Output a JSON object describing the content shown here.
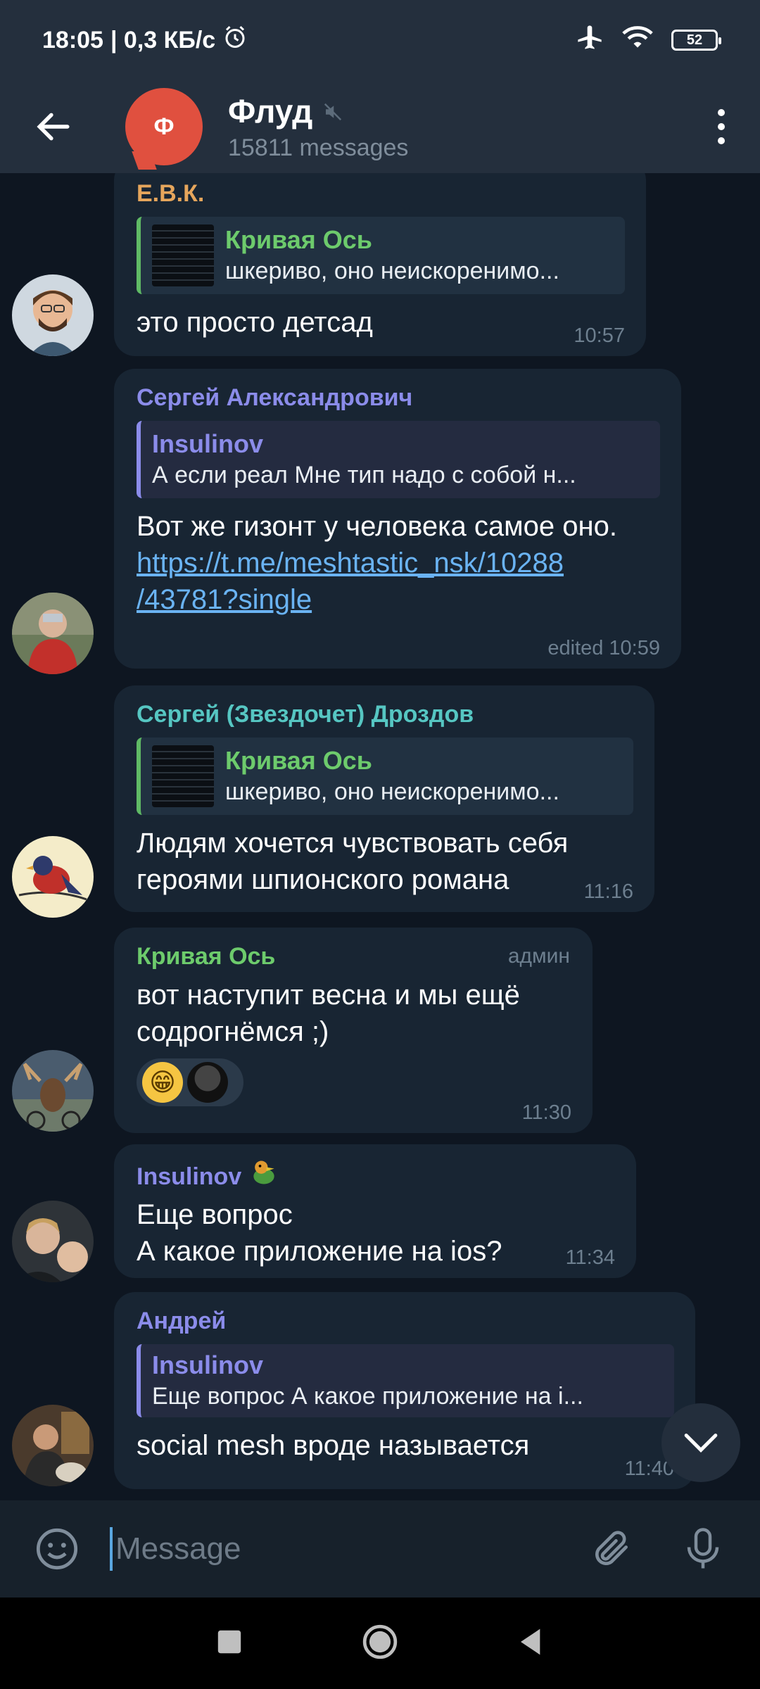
{
  "status_bar": {
    "time": "18:05",
    "speed": "| 0,3 КБ/с",
    "battery": "52"
  },
  "header": {
    "title": "Флуд",
    "subtitle": "15811 messages",
    "avatar_letter": "Ф"
  },
  "messages": [
    {
      "sender": "Е.В.К.",
      "sender_color": "#e6a65c",
      "reply_name": "Кривая Ось",
      "reply_text": "шкериво, оно неискоренимо...",
      "text": "это просто детсад",
      "time": "10:57"
    },
    {
      "sender": "Сергей Александрович",
      "sender_color": "#8b8cea",
      "reply_name": "Insulinov",
      "reply_text": "А если реал  Мне тип надо с собой н...",
      "text": "Вот же гизонт у человека самое оно.",
      "link": "https://t.me/meshtastic_nsk/10288/43781?single",
      "link_line1": "https://t.me/meshtastic_nsk/10288",
      "link_line2": "/43781?single",
      "time": "edited 10:59"
    },
    {
      "sender": "Сергей (Звездочет) Дроздов",
      "sender_color": "#56c6c2",
      "reply_name": "Кривая Ось",
      "reply_text": "шкериво, оно неискоренимо...",
      "text_line1": "Людям хочется чувствовать себя",
      "text_line2": "героями шпионского романа",
      "time": "11:16"
    },
    {
      "sender": "Кривая Ось",
      "sender_color": "#6dcb6c",
      "badge": "админ",
      "text_line1": "вот наступит весна и мы ещё",
      "text_line2": "содрогнёмся ;)",
      "reaction_emoji": "😁",
      "time": "11:30"
    },
    {
      "sender": "Insulinov",
      "sender_color": "#8b8cea",
      "text_line1": "Еще вопрос",
      "text_line2": "А какое приложение на ios?",
      "time": "11:34"
    },
    {
      "sender": "Андрей",
      "sender_color": "#8b8cea",
      "reply_name": "Insulinov",
      "reply_text": "Еще вопрос  А какое приложение на i...",
      "text": "social mesh вроде называется",
      "time": "11:40"
    }
  ],
  "input": {
    "placeholder": "Message"
  }
}
